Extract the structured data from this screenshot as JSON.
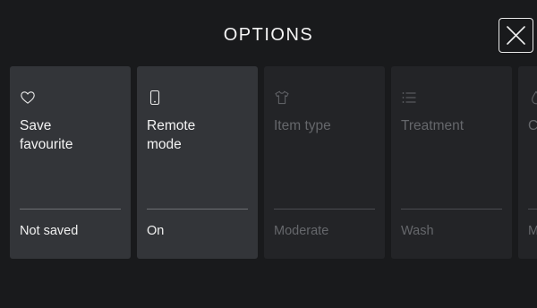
{
  "header": {
    "title": "OPTIONS",
    "close_icon": "close-icon"
  },
  "options": [
    {
      "label": "Save\nfavourite",
      "value": "Not saved",
      "icon": "heart-icon",
      "state": "active"
    },
    {
      "label": "Remote\nmode",
      "value": "On",
      "icon": "phone-icon",
      "state": "active"
    },
    {
      "label": "Item type",
      "value": "Moderate",
      "icon": "shirt-icon",
      "state": "disabled"
    },
    {
      "label": "Treatment",
      "value": "Wash",
      "icon": "list-icon",
      "state": "disabled"
    },
    {
      "label": "C",
      "value": "M",
      "icon": "drop-icon",
      "state": "disabled"
    }
  ],
  "colors": {
    "background": "#191a1c",
    "card": "#2c2d30",
    "card_disabled": "#232427",
    "text": "#f3f3f3",
    "text_disabled": "#65676b",
    "divider": "#6d6f73"
  }
}
